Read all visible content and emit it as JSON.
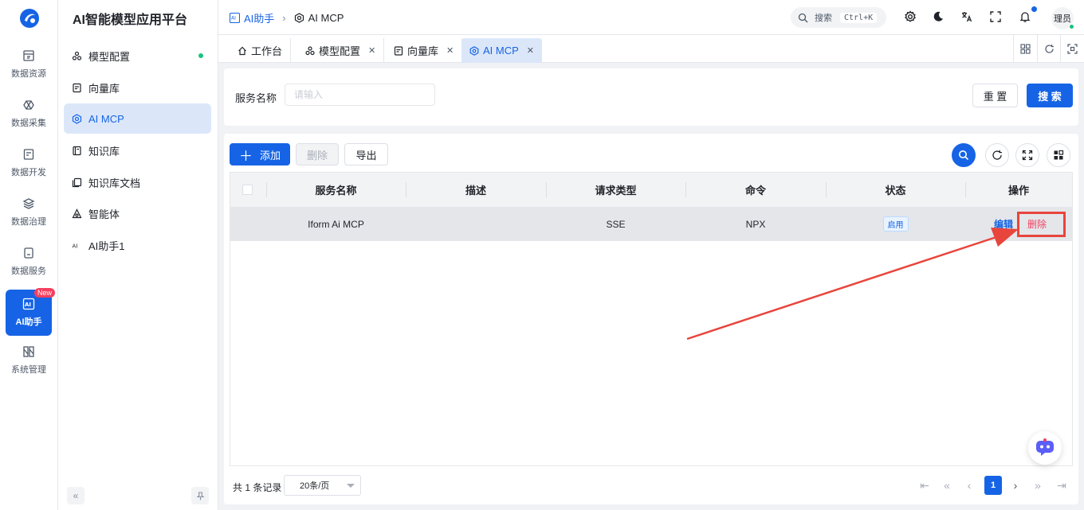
{
  "rail": {
    "items": [
      {
        "label": "数据资源",
        "icon": "database-icon"
      },
      {
        "label": "数据采集",
        "icon": "collect-icon"
      },
      {
        "label": "数据开发",
        "icon": "develop-icon"
      },
      {
        "label": "数据治理",
        "icon": "layers-icon"
      },
      {
        "label": "数据服务",
        "icon": "service-icon"
      },
      {
        "label": "AI助手",
        "icon": "ai-icon",
        "badge": "New"
      },
      {
        "label": "系统管理",
        "icon": "system-icon"
      }
    ]
  },
  "sidebar": {
    "title": "AI智能模型应用平台",
    "items": [
      {
        "label": "模型配置"
      },
      {
        "label": "向量库"
      },
      {
        "label": "AI MCP"
      },
      {
        "label": "知识库"
      },
      {
        "label": "知识库文档"
      },
      {
        "label": "智能体"
      },
      {
        "label": "AI助手1"
      }
    ]
  },
  "header": {
    "breadcrumb": [
      "AI助手",
      "AI MCP"
    ],
    "search_label": "搜索",
    "search_shortcut": "Ctrl+K",
    "user": "理员"
  },
  "tabs": [
    {
      "label": "工作台"
    },
    {
      "label": "模型配置"
    },
    {
      "label": "向量库"
    },
    {
      "label": "AI MCP"
    }
  ],
  "filter": {
    "label": "服务名称",
    "placeholder": "请输入",
    "reset": "重 置",
    "search": "搜 索"
  },
  "toolbar": {
    "add": "添加",
    "delete": "删除",
    "export": "导出"
  },
  "table": {
    "columns": [
      "服务名称",
      "描述",
      "请求类型",
      "命令",
      "状态",
      "操作"
    ],
    "rows": [
      {
        "name": "Iform Ai MCP",
        "desc": "",
        "type": "SSE",
        "command": "NPX",
        "status": "启用",
        "edit": "编辑",
        "delete": "删除"
      }
    ]
  },
  "pager": {
    "total": "共 1 条记录",
    "size": "20条/页",
    "current": "1"
  },
  "colors": {
    "primary": "#1664e5",
    "danger": "#f53f5f",
    "annotation": "#e8453c"
  }
}
